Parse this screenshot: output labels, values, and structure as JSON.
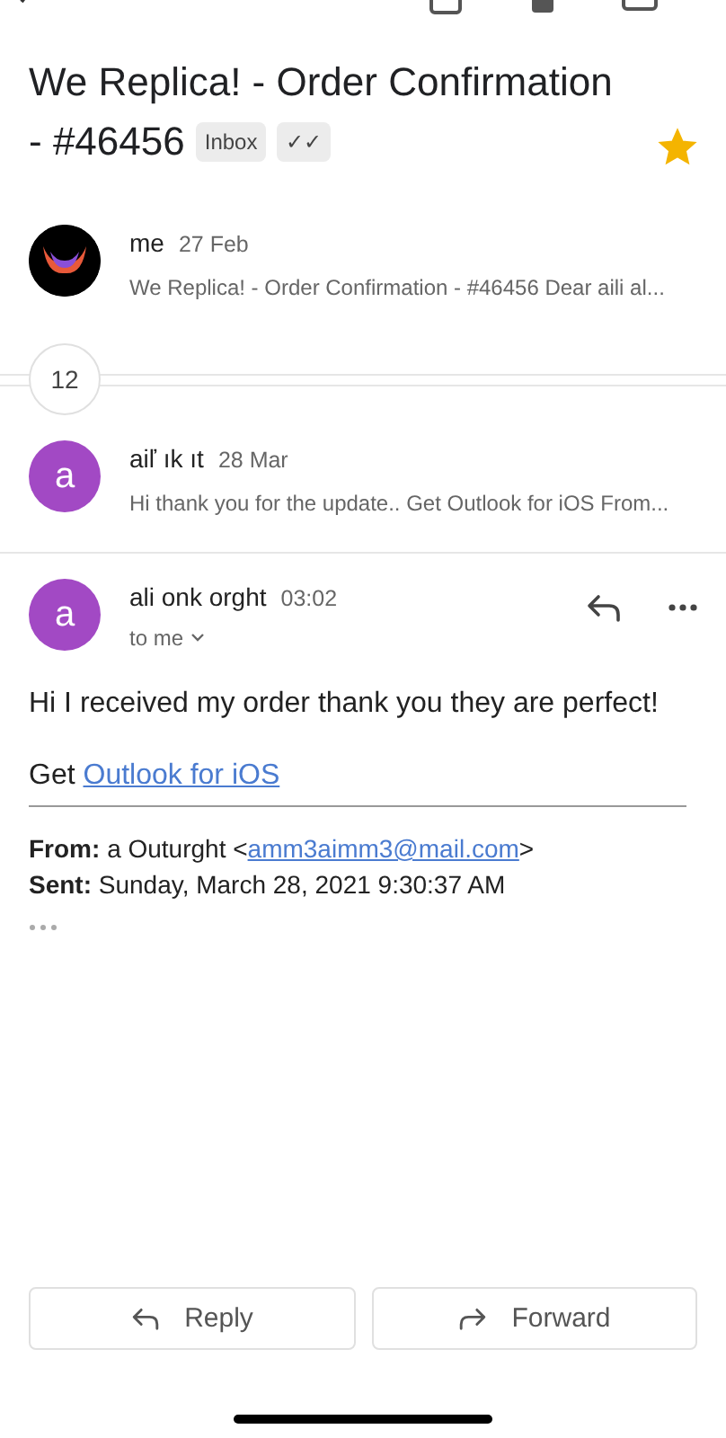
{
  "subject_lines": [
    "We Replica! - Order Confirmation",
    "- #46456"
  ],
  "labels": [
    "Inbox",
    "✓✓"
  ],
  "starred": true,
  "messages": [
    {
      "kind": "collapsed",
      "avatar": {
        "kind": "logo"
      },
      "sender": "me",
      "date": "27 Feb",
      "snippet": "We Replica! - Order Confirmation - #46456 Dear aili al..."
    },
    {
      "kind": "count",
      "count": "12"
    },
    {
      "kind": "collapsed",
      "avatar": {
        "kind": "letter",
        "letter": "a"
      },
      "sender": "aiľ ık ıt",
      "date": "28 Mar",
      "snippet": "Hi thank you for the update.. Get Outlook for iOS From..."
    },
    {
      "kind": "expanded",
      "avatar": {
        "kind": "letter",
        "letter": "a"
      },
      "sender": "ali onk orght",
      "date": "03:02",
      "recipient": "to me",
      "body": "Hi I received my order thank you they are perfect!",
      "link_prefix": "Get",
      "link": "Outlook for iOS",
      "from_label": "From:",
      "from_name": "a Outurght <",
      "from_email": "amm3aimm3@mail.com",
      "from_suffix": ">",
      "sent_label": "Sent:",
      "sent_value": "Sunday, March 28, 2021 9:30:37 AM"
    }
  ],
  "actions": [
    "Reply",
    "Forward"
  ]
}
